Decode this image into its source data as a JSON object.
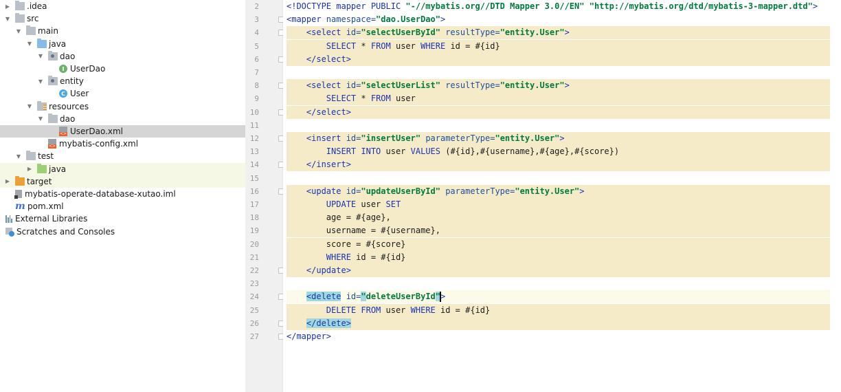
{
  "project_tree": [
    {
      "label": ".idea",
      "depth": 0,
      "arrow": "right",
      "icon": "folder-icon"
    },
    {
      "label": "src",
      "depth": 0,
      "arrow": "down",
      "icon": "folder-icon"
    },
    {
      "label": "main",
      "depth": 1,
      "arrow": "down",
      "icon": "folder-icon"
    },
    {
      "label": "java",
      "depth": 2,
      "arrow": "down",
      "icon": "source-folder-icon"
    },
    {
      "label": "dao",
      "depth": 3,
      "arrow": "down",
      "icon": "package-icon"
    },
    {
      "label": "UserDao",
      "depth": 4,
      "arrow": "none",
      "icon": "interface-icon"
    },
    {
      "label": "entity",
      "depth": 3,
      "arrow": "down",
      "icon": "package-icon"
    },
    {
      "label": "User",
      "depth": 4,
      "arrow": "none",
      "icon": "class-icon"
    },
    {
      "label": "resources",
      "depth": 2,
      "arrow": "down",
      "icon": "resources-folder-icon"
    },
    {
      "label": "dao",
      "depth": 3,
      "arrow": "down",
      "icon": "folder-icon"
    },
    {
      "label": "UserDao.xml",
      "depth": 4,
      "arrow": "none",
      "icon": "xml-file-icon",
      "selected": true
    },
    {
      "label": "mybatis-config.xml",
      "depth": 3,
      "arrow": "none",
      "icon": "xml-file-icon"
    },
    {
      "label": "test",
      "depth": 1,
      "arrow": "down",
      "icon": "folder-icon"
    },
    {
      "label": "java",
      "depth": 2,
      "arrow": "right",
      "icon": "test-source-folder-icon",
      "tinted": true
    },
    {
      "label": "target",
      "depth": 0,
      "arrow": "right",
      "icon": "excluded-folder-icon",
      "tinted": true
    },
    {
      "label": "mybatis-operate-database-xutao.iml",
      "depth": 0,
      "arrow": "none",
      "icon": "module-file-icon"
    },
    {
      "label": "pom.xml",
      "depth": 0,
      "arrow": "none",
      "icon": "maven-icon"
    },
    {
      "label": "External Libraries",
      "depth": -1,
      "arrow": "none",
      "icon": "libraries-icon"
    },
    {
      "label": "Scratches and Consoles",
      "depth": -1,
      "arrow": "none",
      "icon": "scratches-icon"
    }
  ],
  "editor": {
    "lines": [
      {
        "n": "2",
        "hl": false,
        "fold": false,
        "tokens": [
          [
            "tag",
            "<!DOCTYPE mapper PUBLIC "
          ],
          [
            "val",
            "\"-//mybatis.org//DTD Mapper 3.0//EN\""
          ],
          [
            "tag",
            " "
          ],
          [
            "val",
            "\"http://mybatis.org/dtd/mybatis-3-mapper.dtd\""
          ],
          [
            "tag",
            ">"
          ]
        ]
      },
      {
        "n": "3",
        "hl": false,
        "fold": true,
        "tokens": [
          [
            "tag",
            "<mapper "
          ],
          [
            "attr",
            "namespace="
          ],
          [
            "val",
            "\"dao.UserDao\""
          ],
          [
            "tag",
            ">"
          ]
        ]
      },
      {
        "n": "4",
        "hl": true,
        "fold": true,
        "tokens": [
          [
            "plain",
            "    "
          ],
          [
            "tag",
            "<select "
          ],
          [
            "attr",
            "id="
          ],
          [
            "val",
            "\"selectUserById\""
          ],
          [
            "attr",
            " resultType="
          ],
          [
            "val",
            "\"entity.User\""
          ],
          [
            "tag",
            ">"
          ]
        ]
      },
      {
        "n": "5",
        "hl": true,
        "fold": false,
        "tokens": [
          [
            "plain",
            "        "
          ],
          [
            "kw",
            "SELECT"
          ],
          [
            "plain",
            " * "
          ],
          [
            "kw",
            "FROM"
          ],
          [
            "plain",
            " user "
          ],
          [
            "kw",
            "WHERE"
          ],
          [
            "plain",
            " id = #{id}"
          ]
        ]
      },
      {
        "n": "6",
        "hl": true,
        "fold": true,
        "tokens": [
          [
            "plain",
            "    "
          ],
          [
            "tag",
            "</select>"
          ]
        ]
      },
      {
        "n": "7",
        "hl": false,
        "fold": false,
        "tokens": []
      },
      {
        "n": "8",
        "hl": true,
        "fold": true,
        "tokens": [
          [
            "plain",
            "    "
          ],
          [
            "tag",
            "<select "
          ],
          [
            "attr",
            "id="
          ],
          [
            "val",
            "\"selectUserList\""
          ],
          [
            "attr",
            " resultType="
          ],
          [
            "val",
            "\"entity.User\""
          ],
          [
            "tag",
            ">"
          ]
        ]
      },
      {
        "n": "9",
        "hl": true,
        "fold": false,
        "tokens": [
          [
            "plain",
            "        "
          ],
          [
            "kw",
            "SELECT"
          ],
          [
            "plain",
            " * "
          ],
          [
            "kw",
            "FROM"
          ],
          [
            "plain",
            " user"
          ]
        ]
      },
      {
        "n": "10",
        "hl": true,
        "fold": true,
        "tokens": [
          [
            "plain",
            "    "
          ],
          [
            "tag",
            "</select>"
          ]
        ]
      },
      {
        "n": "11",
        "hl": false,
        "fold": false,
        "tokens": []
      },
      {
        "n": "12",
        "hl": true,
        "fold": true,
        "tokens": [
          [
            "plain",
            "    "
          ],
          [
            "tag",
            "<insert "
          ],
          [
            "attr",
            "id="
          ],
          [
            "val",
            "\"insertUser\""
          ],
          [
            "attr",
            " parameterType="
          ],
          [
            "val",
            "\"entity.User\""
          ],
          [
            "tag",
            ">"
          ]
        ]
      },
      {
        "n": "13",
        "hl": true,
        "fold": false,
        "tokens": [
          [
            "plain",
            "        "
          ],
          [
            "kw",
            "INSERT INTO"
          ],
          [
            "plain",
            " user "
          ],
          [
            "kw",
            "VALUES"
          ],
          [
            "plain",
            " (#{id},#{username},#{age},#{score})"
          ]
        ]
      },
      {
        "n": "14",
        "hl": true,
        "fold": true,
        "tokens": [
          [
            "plain",
            "    "
          ],
          [
            "tag",
            "</insert>"
          ]
        ]
      },
      {
        "n": "15",
        "hl": false,
        "fold": false,
        "tokens": []
      },
      {
        "n": "16",
        "hl": true,
        "fold": true,
        "tokens": [
          [
            "plain",
            "    "
          ],
          [
            "tag",
            "<update "
          ],
          [
            "attr",
            "id="
          ],
          [
            "val",
            "\"updateUserById\""
          ],
          [
            "attr",
            " parameterType="
          ],
          [
            "val",
            "\"entity.User\""
          ],
          [
            "tag",
            ">"
          ]
        ]
      },
      {
        "n": "17",
        "hl": true,
        "fold": false,
        "tokens": [
          [
            "plain",
            "        "
          ],
          [
            "kw",
            "UPDATE"
          ],
          [
            "plain",
            " user "
          ],
          [
            "kw",
            "SET"
          ]
        ]
      },
      {
        "n": "18",
        "hl": true,
        "fold": false,
        "tokens": [
          [
            "plain",
            "        age = #{age},"
          ]
        ]
      },
      {
        "n": "19",
        "hl": true,
        "fold": false,
        "tokens": [
          [
            "plain",
            "        username = #{username},"
          ]
        ]
      },
      {
        "n": "20",
        "hl": true,
        "fold": false,
        "tokens": [
          [
            "plain",
            "        score = #{score}"
          ]
        ]
      },
      {
        "n": "21",
        "hl": true,
        "fold": false,
        "tokens": [
          [
            "plain",
            "        "
          ],
          [
            "kw",
            "WHERE"
          ],
          [
            "plain",
            " id = #{id}"
          ]
        ]
      },
      {
        "n": "22",
        "hl": true,
        "fold": true,
        "tokens": [
          [
            "plain",
            "    "
          ],
          [
            "tag",
            "</update>"
          ]
        ]
      },
      {
        "n": "23",
        "hl": false,
        "fold": false,
        "tokens": []
      },
      {
        "n": "24",
        "hl": true,
        "cur": true,
        "fold": true,
        "tokens": [
          [
            "plain",
            "    "
          ],
          [
            "tagm",
            "<delete"
          ],
          [
            "attr",
            " id="
          ],
          [
            "valm",
            "\""
          ],
          [
            "val",
            "deleteUserById"
          ],
          [
            "valm",
            "\""
          ],
          [
            "caret",
            ""
          ],
          [
            "tag",
            ">"
          ]
        ]
      },
      {
        "n": "25",
        "hl": true,
        "fold": false,
        "tokens": [
          [
            "plain",
            "        "
          ],
          [
            "kw",
            "DELETE FROM"
          ],
          [
            "plain",
            " user "
          ],
          [
            "kw",
            "WHERE"
          ],
          [
            "plain",
            " id = #{id}"
          ]
        ]
      },
      {
        "n": "26",
        "hl": true,
        "fold": true,
        "tokens": [
          [
            "plain",
            "    "
          ],
          [
            "tagm",
            "</delete>"
          ]
        ]
      },
      {
        "n": "27",
        "hl": false,
        "fold": true,
        "tokens": [
          [
            "tag",
            "</mapper>"
          ]
        ]
      }
    ]
  }
}
